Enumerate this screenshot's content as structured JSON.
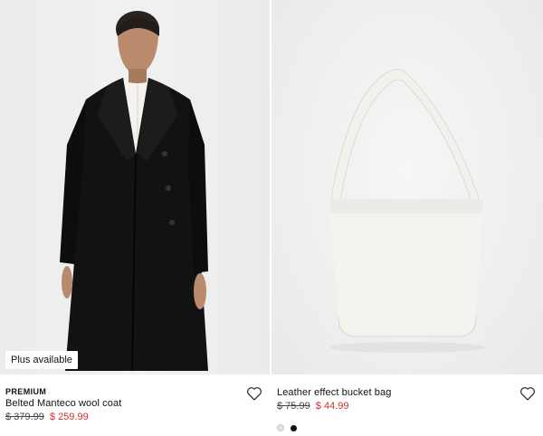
{
  "products": [
    {
      "badge": "Plus available",
      "tag": "PREMIUM",
      "name": "Belted Manteco wool coat",
      "old_price": "$ 379.99",
      "new_price": "$ 259.99",
      "image_icon": "model-wearing-black-coat"
    },
    {
      "name": "Leather effect bucket bag",
      "old_price": "$ 75.99",
      "new_price": "$ 44.99",
      "image_icon": "white-bucket-bag",
      "swatches": [
        "off-white",
        "black"
      ]
    }
  ],
  "colors": {
    "sale_price": "#d0312d",
    "text": "#111111"
  },
  "icons": {
    "favorite": "heart-outline-icon"
  }
}
